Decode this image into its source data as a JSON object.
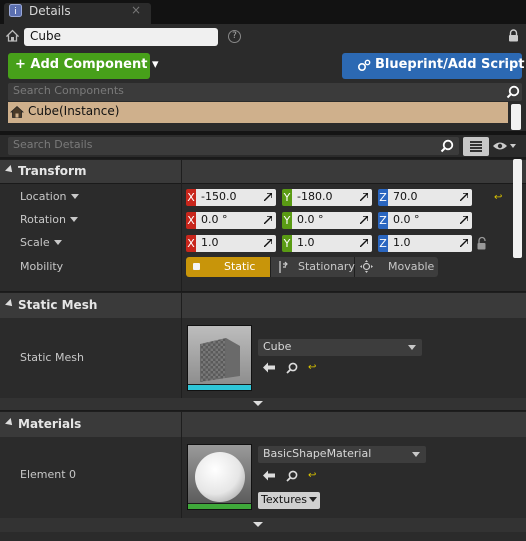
{
  "tab": {
    "title": "Details",
    "close": "×"
  },
  "header": {
    "actor_name": "Cube",
    "help": "?",
    "add_component": "+ Add Component ▾",
    "blueprint_script": "Blueprint/Add Script",
    "search_components_placeholder": "Search Components",
    "component_instance": "Cube(Instance)",
    "search_details_placeholder": "Search Details"
  },
  "transform": {
    "title": "Transform",
    "location_label": "Location",
    "rotation_label": "Rotation",
    "scale_label": "Scale",
    "mobility_label": "Mobility",
    "location": {
      "x": "-150.0",
      "y": "-180.0",
      "z": "70.0"
    },
    "rotation": {
      "x": "0.0 °",
      "y": "0.0 °",
      "z": "0.0 °"
    },
    "scale": {
      "x": "1.0",
      "y": "1.0",
      "z": "1.0"
    },
    "axis": {
      "x": "X",
      "y": "Y",
      "z": "Z"
    },
    "reset": "↩",
    "mobility_options": {
      "static": "Static",
      "stationary": "Stationary",
      "movable": "Movable"
    },
    "mobility_selected": "Static"
  },
  "static_mesh": {
    "title": "Static Mesh",
    "label": "Static Mesh",
    "asset": "Cube"
  },
  "materials": {
    "title": "Materials",
    "element_label": "Element 0",
    "asset": "BasicShapeMaterial",
    "textures_button": "Textures"
  },
  "colors": {
    "add_component": "#47a01a",
    "blueprint": "#2c69b3",
    "selected_component": "#cfb08c",
    "mobility_static": "#c8950a",
    "axis_x": "#c8261c",
    "axis_y": "#5a9b14",
    "axis_z": "#2a66c0",
    "mesh_bar": "#2fc6d8",
    "material_bar": "#3fa83a"
  }
}
